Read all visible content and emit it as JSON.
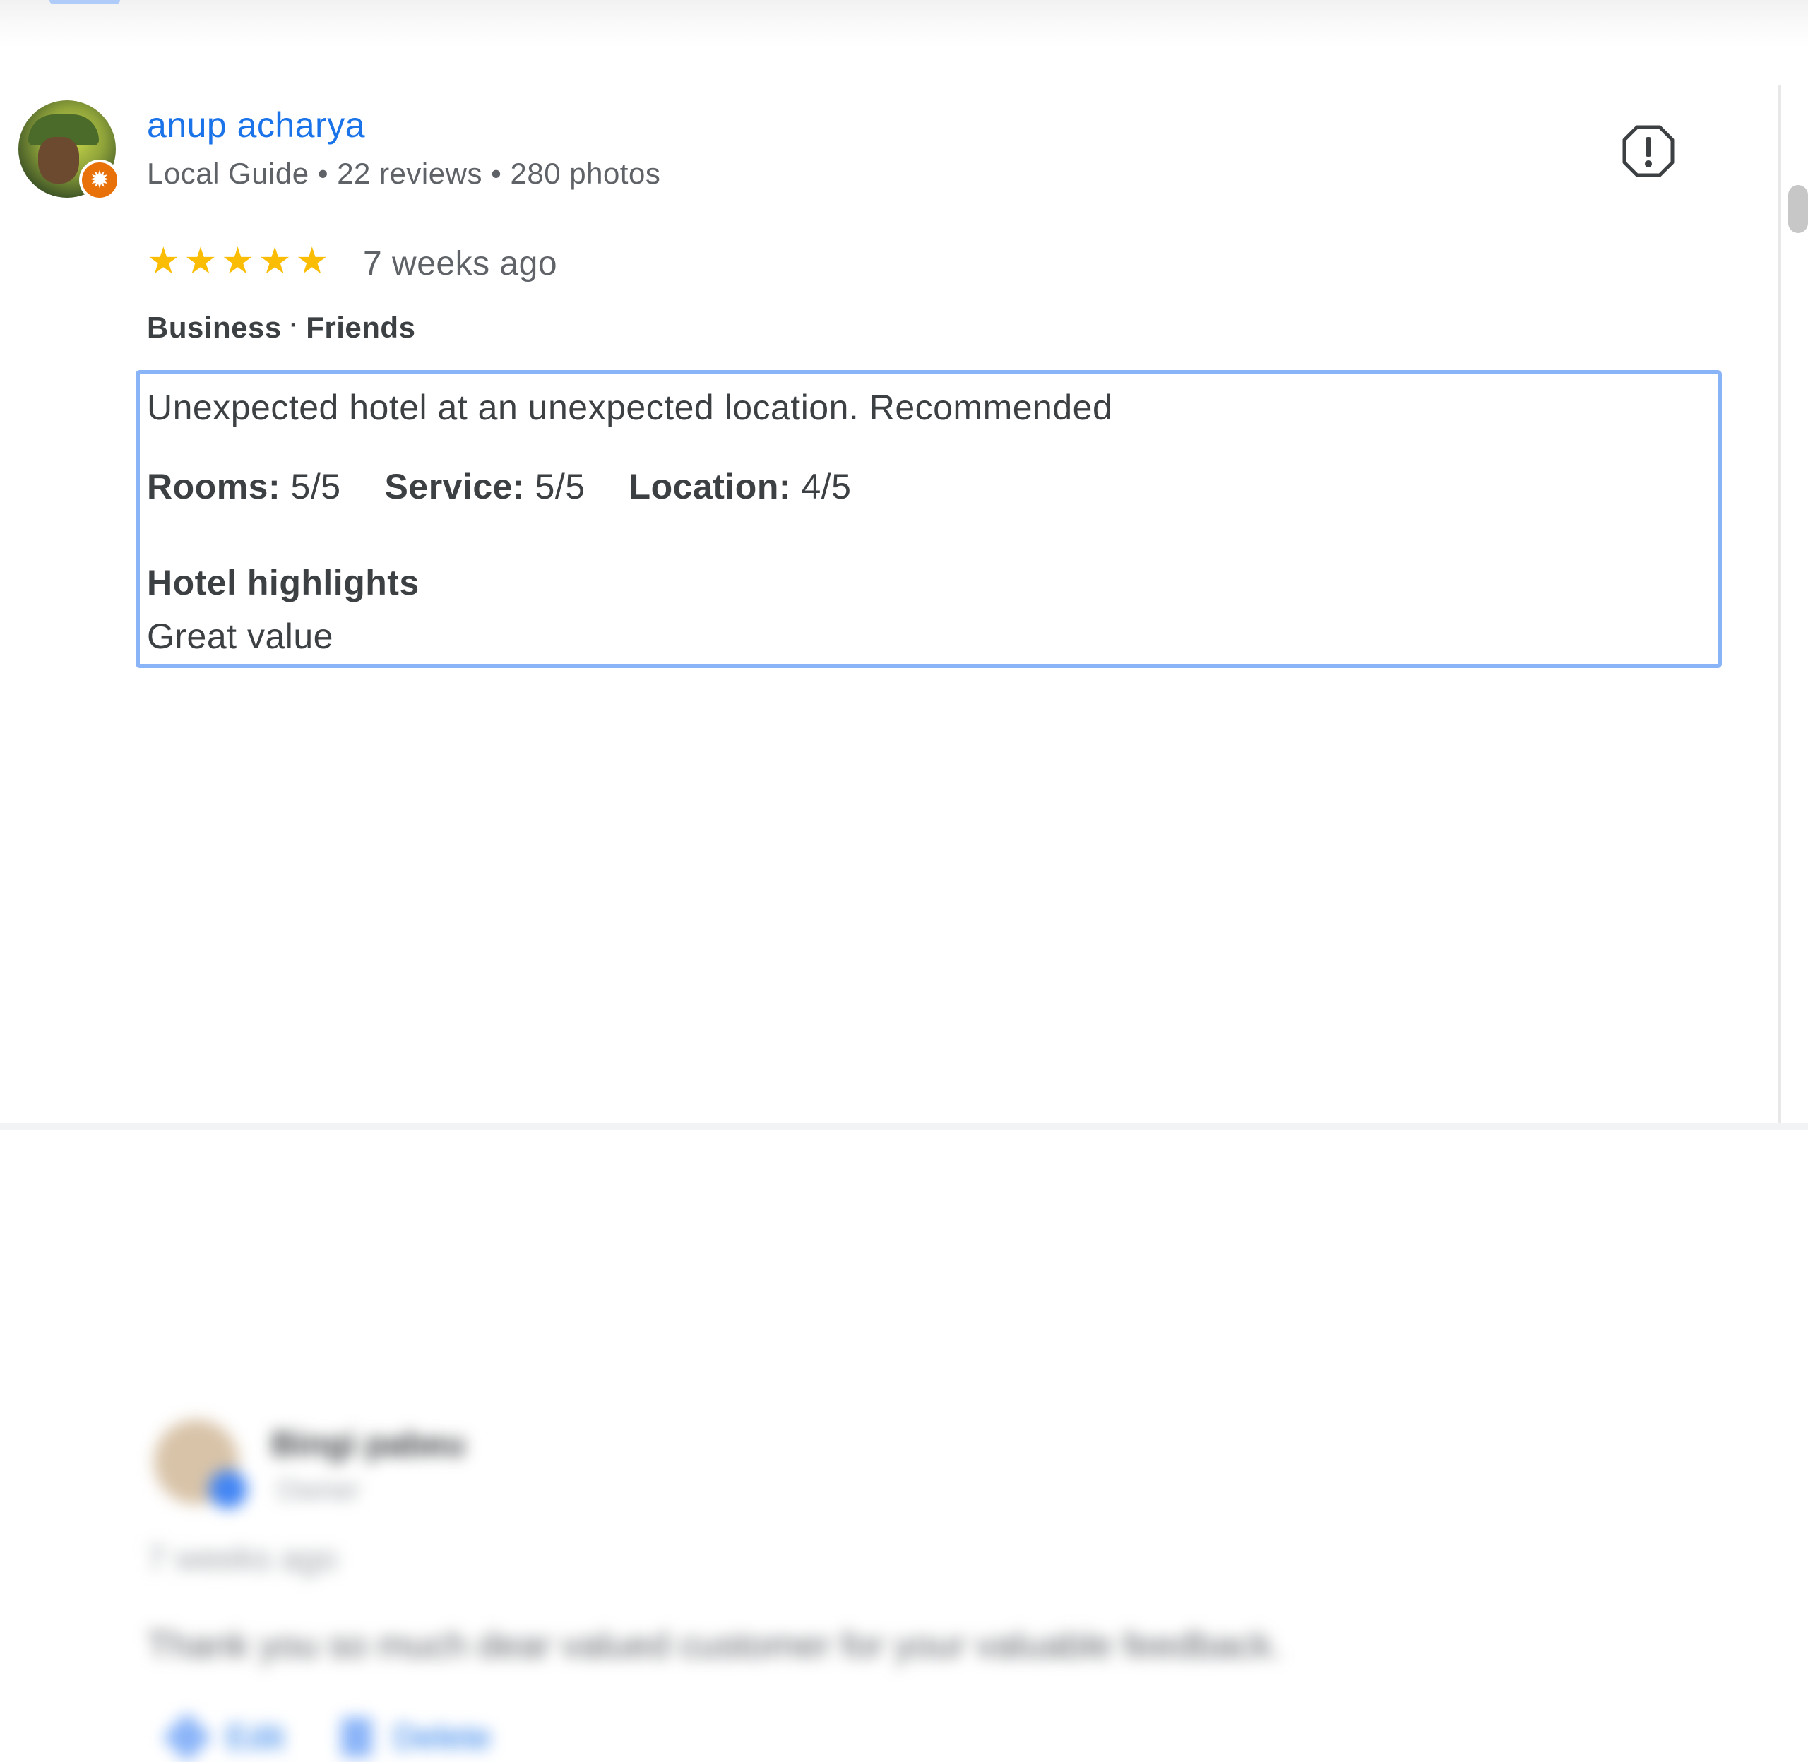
{
  "reviewer": {
    "name": "anup acharya",
    "meta": "Local Guide • 22 reviews • 280 photos",
    "badge_icon": "local-guide-star-icon"
  },
  "review": {
    "rating": 5,
    "max_rating": 5,
    "time": "7 weeks ago",
    "trip_type": "Business",
    "traveled_with": "Friends",
    "text": "Unexpected hotel at an unexpected location. Recommended",
    "ratings": [
      {
        "label": "Rooms:",
        "value": "5/5"
      },
      {
        "label": "Service:",
        "value": "5/5"
      },
      {
        "label": "Location:",
        "value": "4/5"
      }
    ],
    "highlights_title": "Hotel highlights",
    "highlights_value": "Great value"
  },
  "next_review": {
    "name": "Bingi pabeu",
    "sub": "Owner",
    "time": "7 weeks ago",
    "text": "Thank you so much dear valued customer for your valuable feedback.",
    "edit_label": "Edit",
    "delete_label": "Delete"
  },
  "colors": {
    "link": "#1a73e8",
    "star": "#fbbc04",
    "highlight_border": "#8ab4f8",
    "local_guide_badge": "#e8710a"
  }
}
